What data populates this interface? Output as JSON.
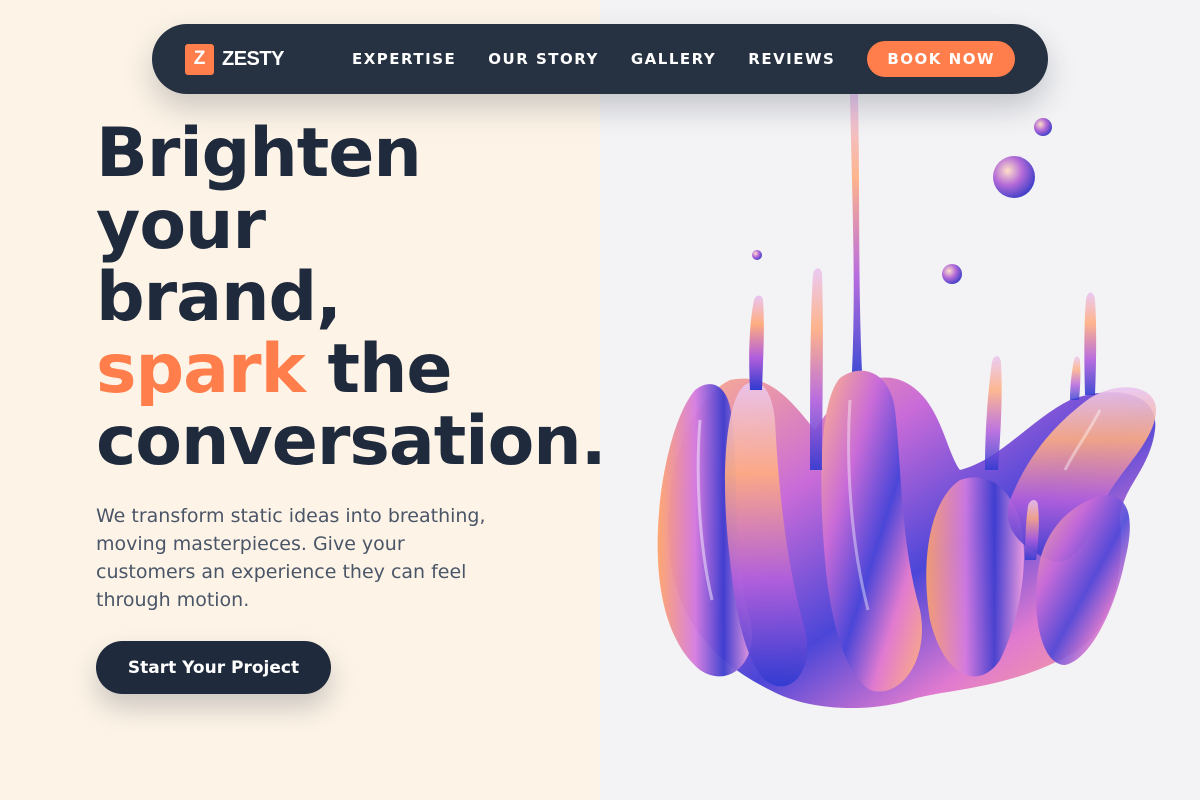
{
  "brand": {
    "logo_letter": "Z",
    "name": "ZESTY",
    "accent_color": "#ff7e4b",
    "dark_color": "#1f2a3c"
  },
  "nav": {
    "items": [
      {
        "label": "EXPERTISE"
      },
      {
        "label": "OUR STORY"
      },
      {
        "label": "GALLERY"
      },
      {
        "label": "REVIEWS"
      }
    ],
    "cta_label": "BOOK NOW"
  },
  "hero": {
    "headline": {
      "line1": "Brighten",
      "line2": "your",
      "line3": "brand,",
      "accent_word": "spark",
      "line4_rest": " the",
      "line5": "conversation."
    },
    "subtext": "We transform static ideas into breathing, moving masterpieces. Give your customers an experience they can feel through motion.",
    "cta_label": "Start Your Project"
  },
  "visual": {
    "image": "iridescent-liquid-splash-illustration"
  }
}
